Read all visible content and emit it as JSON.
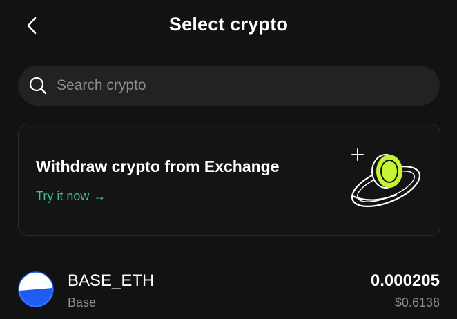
{
  "header": {
    "back_icon": "chevron-left-icon",
    "title": "Select crypto"
  },
  "search": {
    "icon": "search-icon",
    "placeholder": "Search crypto",
    "value": ""
  },
  "promo": {
    "title": "Withdraw crypto from Exchange",
    "link_label": "Try it now",
    "link_arrow": "→",
    "illustration": "coin-orbit-illustration",
    "accent_color": "#3ac290",
    "coin_color": "#c6f432"
  },
  "assets": [
    {
      "symbol": "BASE_ETH",
      "network": "Base",
      "amount": "0.000205",
      "value": "$0.6138",
      "icon": "base-eth-icon",
      "icon_color": "#1f5cf0"
    }
  ],
  "colors": {
    "background": "#121212",
    "surface": "#222222",
    "muted_text": "#8c8c8c"
  }
}
